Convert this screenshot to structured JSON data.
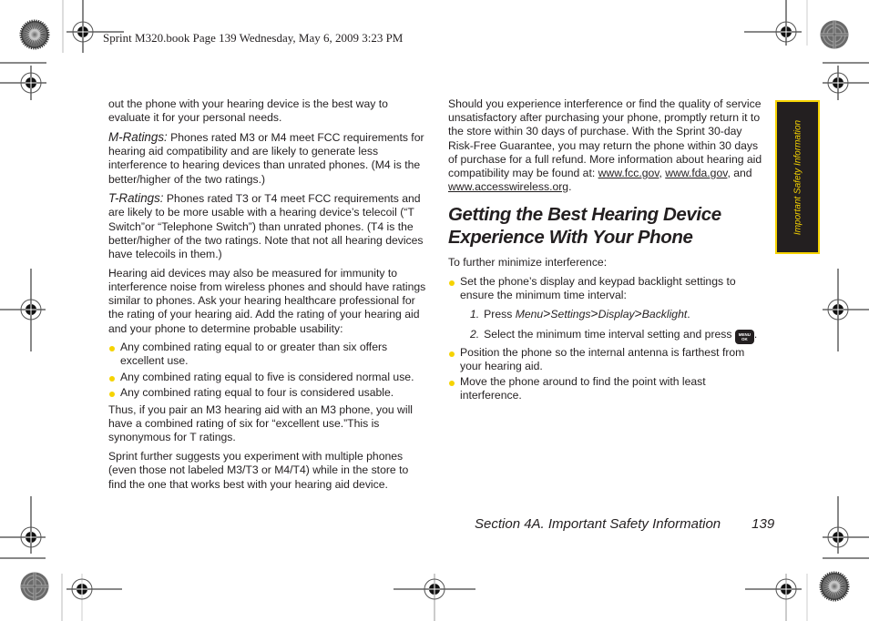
{
  "header": {
    "print_info": "Sprint M320.book  Page 139  Wednesday, May 6, 2009  3:23 PM"
  },
  "left_column": {
    "intro": "out the phone with your hearing device is the best way to evaluate it for your personal needs.",
    "m_ratings": {
      "label": "M-Ratings:",
      "text": " Phones rated M3 or M4 meet FCC requirements for hearing aid compatibility and are likely to generate less interference to hearing devices than unrated phones. (M4 is the better/higher of the two ratings.)"
    },
    "t_ratings": {
      "label": "T-Ratings:",
      "text": " Phones rated T3 or T4 meet FCC requirements and are likely to be more usable with a hearing device’s telecoil (“T Switch”or “Telephone Switch”) than unrated phones. (T4 is the better/higher of the two ratings. Note that not all hearing devices have telecoils in them.)"
    },
    "immunity": "Hearing aid devices may also be measured for immunity to interference noise from wireless phones and should have ratings similar to phones. Ask your hearing healthcare professional for the rating of your hearing aid. Add the rating of your hearing aid and your phone to determine probable usability:",
    "bullets": [
      "Any combined rating equal to or greater than six offers excellent use.",
      "Any combined rating equal to five is considered normal use.",
      "Any combined rating equal to four is considered usable."
    ],
    "thus": "Thus, if you pair an M3 hearing aid with an M3 phone, you will have a combined rating of six for “excellent use.”This is synonymous for T ratings.",
    "suggest": "Sprint further suggests you experiment with multiple phones (even those not labeled M3/T3 or M4/T4) while in the store to find the one that works best with your hearing aid device."
  },
  "right_column": {
    "interference": "Should you experience interference or find the quality of service unsatisfactory after purchasing your phone, promptly return it to the store within 30 days of purchase. With the Sprint 30-day Risk-Free Guarantee, you may return the phone within 30 days of purchase for a full refund. More information about hearing aid compatibility may be found at: ",
    "links": [
      "www.fcc.gov",
      "www.fda.gov",
      "www.accesswireless.org"
    ],
    "link_sep1": ", ",
    "link_sep2": ", and ",
    "link_end": ".",
    "section_title": "Getting the Best Hearing Device Experience With Your Phone",
    "minimize": "To further minimize interference:",
    "bullet1": "Set the phone’s display and keypad backlight settings to ensure the minimum time interval:",
    "steps": [
      {
        "num": "1.",
        "prefix": "Press ",
        "path": [
          "Menu",
          "Settings",
          "Display",
          "Backlight"
        ],
        "separator": ">",
        "suffix": "."
      },
      {
        "num": "2.",
        "text": "Select the minimum time interval setting and press ",
        "key_icon": "menu-ok-key",
        "key_label_top": "MENU",
        "key_label_bottom": "OK",
        "suffix": "."
      }
    ],
    "bullets": [
      "Position the phone so the internal antenna is farthest from your hearing aid.",
      "Move the phone around to find the point with least interference."
    ]
  },
  "side_tab": {
    "label": "Important Safety Information"
  },
  "footer": {
    "section": "Section 4A. Important Safety Information",
    "page_number": "139"
  },
  "colors": {
    "accent_yellow": "#f6d300",
    "text": "#231f20",
    "tab_background": "#231f20"
  }
}
